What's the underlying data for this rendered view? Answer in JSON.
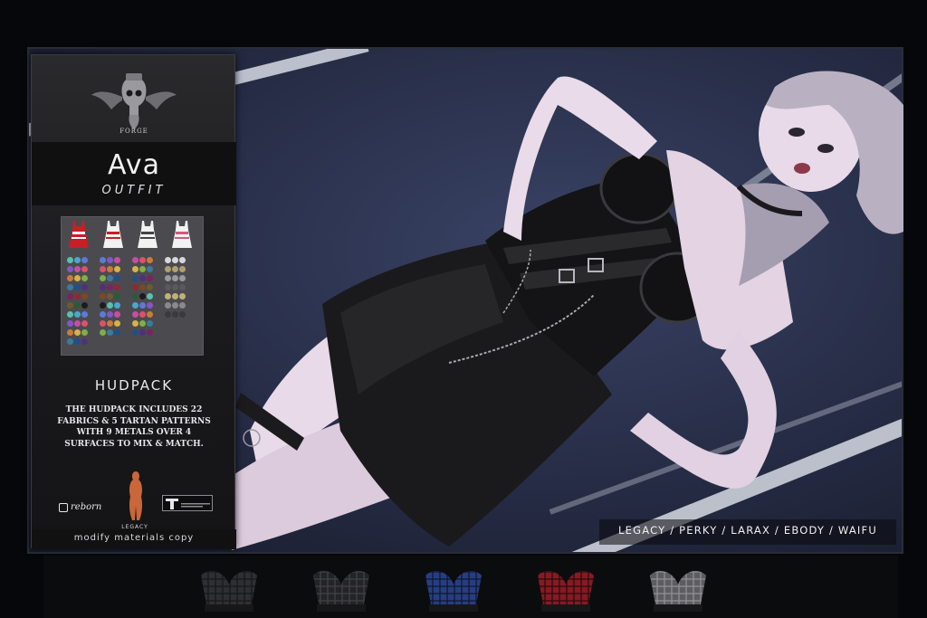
{
  "brand": {
    "name": "FORGE"
  },
  "product": {
    "name": "Ava",
    "category": "OUTFIT"
  },
  "hud": {
    "title": "HUDPACK",
    "description_lines": [
      "THE HUDPACK INCLUDES 22",
      "FABRICS & 5 TARTAN PATTERNS",
      "WITH 9 METALS OVER 4",
      "SURFACES TO MIX & MATCH."
    ]
  },
  "body_logos": {
    "reborn": "reborn",
    "legacy": "LEGACY"
  },
  "footer": {
    "permissions": "modify materials copy"
  },
  "compatibility": {
    "bodies": "LEGACY / PERKY / LARAX / EBODY / WAIFU"
  },
  "colors": {
    "background": "#06070a",
    "poster_bg": "#2c3350",
    "panel_bg": "#1c1c1e",
    "dress_black": "#1a1a1c",
    "skin": "#e6d9e6",
    "hair": "#b9b1c2"
  },
  "dress_icons": [
    {
      "name": "red",
      "color": "#c81e26",
      "accent": "#ffffff"
    },
    {
      "name": "white-red",
      "color": "#f2f2f2",
      "accent": "#c81e26"
    },
    {
      "name": "white-dark",
      "color": "#f2f2f2",
      "accent": "#444444"
    },
    {
      "name": "white-pink",
      "color": "#f2f2f2",
      "accent": "#d05a7a"
    }
  ],
  "variants": [
    {
      "name": "black-tartan",
      "color": "#3a3a3e",
      "check": "#1b1b1e"
    },
    {
      "name": "charcoal-tartan",
      "color": "#2c2c30",
      "check": "#55555a"
    },
    {
      "name": "blue-tartan",
      "color": "#2f4fa6",
      "check": "#12163a"
    },
    {
      "name": "red-tartan",
      "color": "#b01f27",
      "check": "#2a0c10"
    },
    {
      "name": "grey-tartan",
      "color": "#77777c",
      "check": "#c0c0c4"
    }
  ]
}
